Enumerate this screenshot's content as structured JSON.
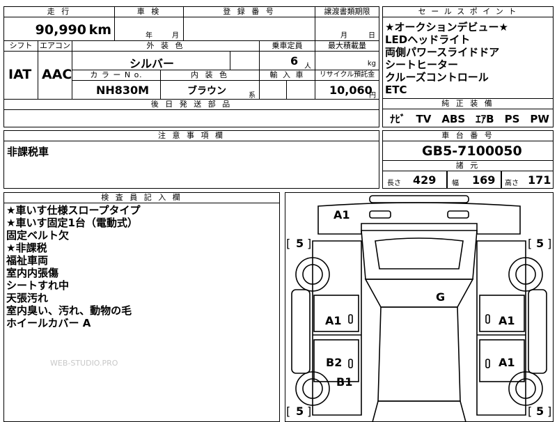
{
  "top_header": {
    "mileage_label": "走 行",
    "inspection_label": "車 検",
    "registration_label": "登 録 番 号",
    "transfer_doc_label": "譲渡書類期限"
  },
  "mileage": {
    "value": "90,990",
    "unit": "km"
  },
  "inspection": {
    "year_unit": "年",
    "month_unit": "月"
  },
  "transfer_doc": {
    "month_unit": "月",
    "day_unit": "日"
  },
  "row2_labels": {
    "shift": "シフト",
    "aircon": "エアコン",
    "exterior_color": "外 装 色",
    "capacity": "乗車定員",
    "max_load": "最大積載量"
  },
  "shift": "IAT",
  "aircon": "AAC",
  "exterior_color": "シルバー",
  "capacity": {
    "value": "6",
    "unit": "人"
  },
  "max_load": {
    "unit": "kg"
  },
  "row3_labels": {
    "color_no": "カ ラ ー N o.",
    "interior_color": "内 装 色",
    "imported": "輸 入 車",
    "recycle": "リサイクル預託金"
  },
  "color_no": "NH830M",
  "interior_color": {
    "value": "ブラウン",
    "suffix": "系"
  },
  "recycle": {
    "value": "10,060",
    "unit": "円"
  },
  "aftermarket_label": "後 日 発 送 部 品",
  "selling_points": {
    "label": "セ ー ル ス ポ イ ン ト",
    "items": [
      "★オークションデビュー★",
      "LEDヘッドライト",
      "両側パワースライドドア",
      "シートヒーター",
      "クルーズコントロール",
      "ETC"
    ]
  },
  "standard_equipment": {
    "label": "純 正 装 備",
    "value": "ﾅﾋﾞ　TV　ABS　ｴｱB　PS　PW"
  },
  "notes": {
    "label": "注 意 事 項 欄",
    "text": "非課税車"
  },
  "chassis": {
    "label": "車 台 番 号",
    "value": "GB5-7100050"
  },
  "specs": {
    "label": "諸 元",
    "length_label": "長さ",
    "length": "429",
    "width_label": "幅",
    "width": "169",
    "height_label": "高さ",
    "height": "171"
  },
  "inspector": {
    "label": "検 査 員 記 入 欄",
    "items": [
      "★車いす仕様スロープタイプ",
      "★車いす固定1台（電動式）",
      "固定ベルト欠",
      "★非課税",
      "福祉車両",
      "室内内張傷",
      "シートすれ中",
      "天張汚れ",
      "室内臭い、汚れ、動物の毛",
      "ホイールカバー A"
    ]
  },
  "watermark": "WEB-STUDIO.PRO",
  "diagram": {
    "front_grade": "A1",
    "center_grade": "G",
    "left_front": "A1",
    "right_front": "A1",
    "left_rear": "B2",
    "left_rear2": "B1",
    "right_rear": "A1",
    "tire_fl": "5",
    "tire_fr": "5",
    "tire_rl": "5",
    "tire_rr": "5"
  }
}
